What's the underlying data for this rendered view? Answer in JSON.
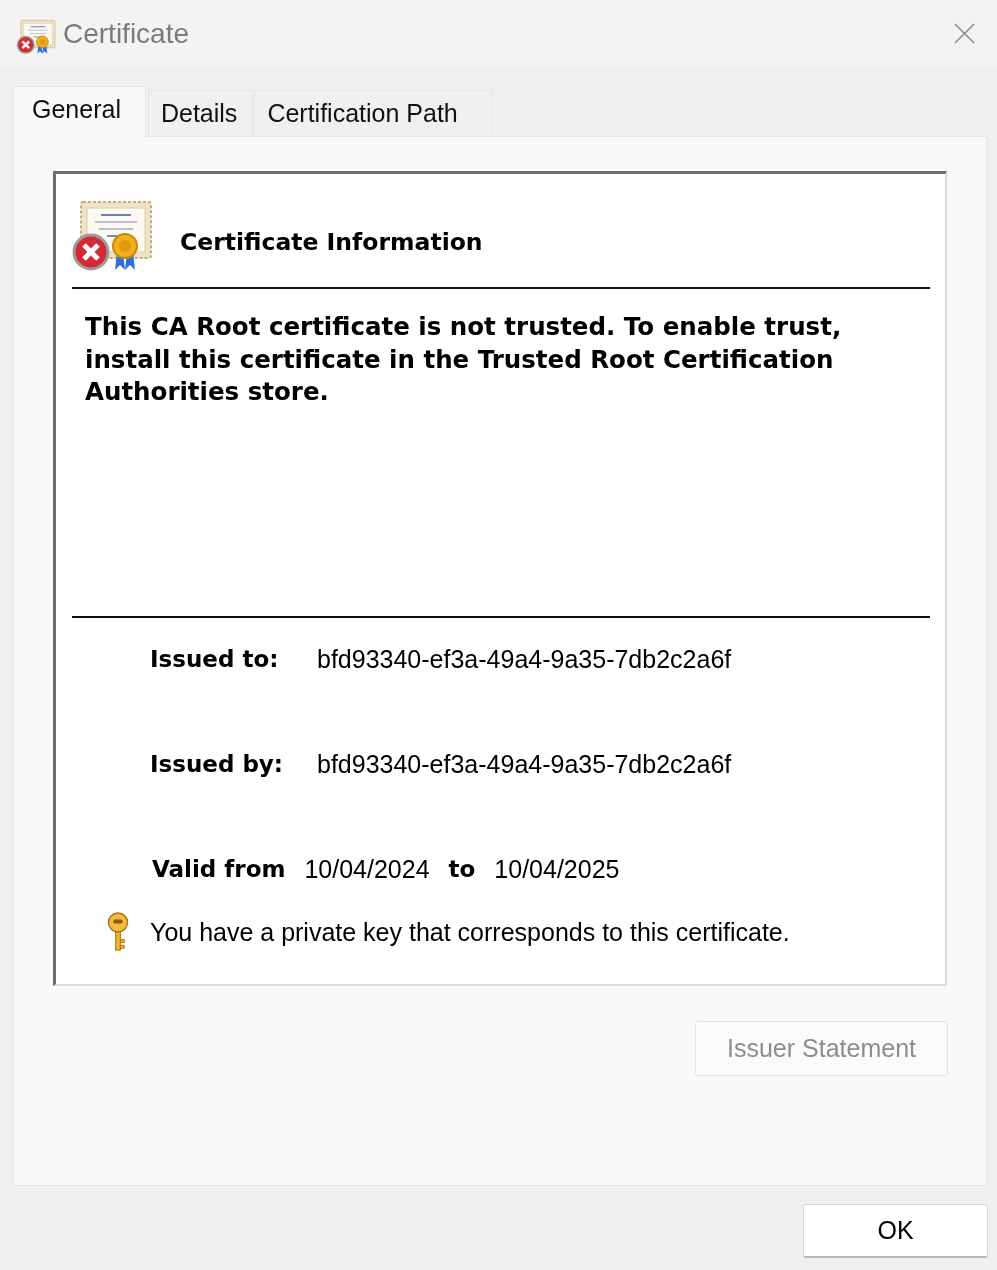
{
  "window": {
    "title": "Certificate"
  },
  "tabs": [
    {
      "label": "General",
      "selected": true
    },
    {
      "label": "Details",
      "selected": false
    },
    {
      "label": "Certification Path",
      "selected": false
    }
  ],
  "general": {
    "trusted": false,
    "heading": "Certificate Information",
    "message": "This CA Root certificate is not trusted. To enable trust, install this certificate in the Trusted Root Certification Authorities store.",
    "issued_to": {
      "label": "Issued to:",
      "value": "bfd93340-ef3a-49a4-9a35-7db2c2a6f"
    },
    "issued_by": {
      "label": "Issued by:",
      "value": "bfd93340-ef3a-49a4-9a35-7db2c2a6f"
    },
    "validity": {
      "from_label": "Valid from",
      "from": "10/04/2024",
      "to_label": "to",
      "to": "10/04/2025"
    },
    "private_key_note": "You have a private key that corresponds to this certificate.",
    "issuer_statement_button": {
      "label": "Issuer Statement",
      "disabled": true
    }
  },
  "buttons": [
    {
      "label": "OK"
    }
  ]
}
